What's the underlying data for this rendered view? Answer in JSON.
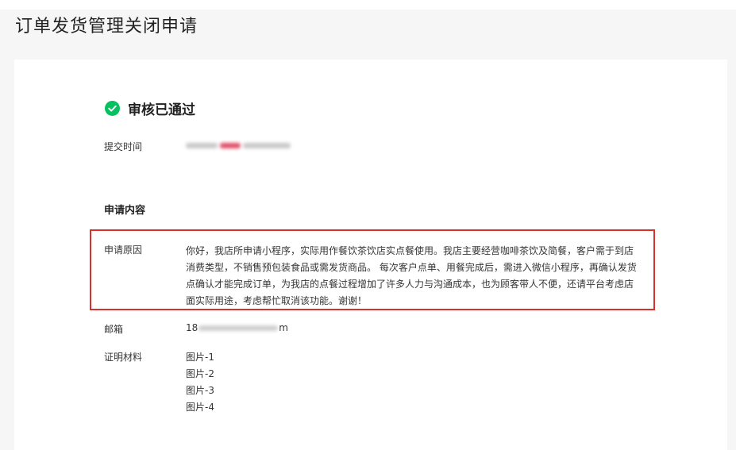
{
  "page": {
    "title": "订单发货管理关闭申请"
  },
  "status": {
    "icon": "check-circle-icon",
    "text": "审核已通过",
    "color": "#07c160"
  },
  "submit_time": {
    "label": "提交时间"
  },
  "application": {
    "section_title": "申请内容",
    "reason_label": "申请原因",
    "reason_text": "你好，我店所申请小程序，实际用作餐饮茶饮店实点餐使用。我店主要经营咖啡茶饮及简餐，客户需于到店消费类型，不销售预包装食品或需发货商品。 每次客户点单、用餐完成后，需进入微信小程序，再确认发货点确认才能完成订单，为我店的点餐过程增加了许多人力与沟通成本，也为顾客带人不便，还请平台考虑店面实际用途，考虑帮忙取消该功能。谢谢！",
    "email_label": "邮箱",
    "email_prefix": "18",
    "email_suffix": "m",
    "materials_label": "证明材料",
    "materials": [
      "图片-1",
      "图片-2",
      "图片-3",
      "图片-4"
    ]
  },
  "highlight_color": "#d9302c"
}
